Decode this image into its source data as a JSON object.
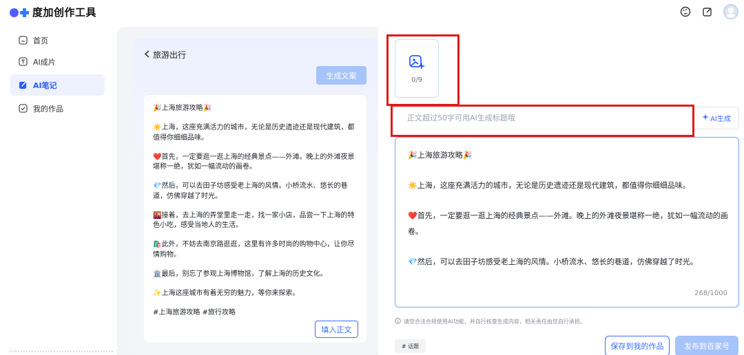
{
  "app": {
    "title": "度加创作工具"
  },
  "colors": {
    "accent": "#2b5cff",
    "highlight_box": "#e11a1a",
    "disabled_button": "#a6c3fb"
  },
  "sidebar": {
    "items": [
      {
        "label": "首页",
        "icon": "home-icon"
      },
      {
        "label": "AI成片",
        "icon": "ai-video-icon"
      },
      {
        "label": "AI笔记",
        "icon": "ai-note-icon",
        "active": true
      },
      {
        "label": "我的作品",
        "icon": "my-works-icon"
      }
    ]
  },
  "left": {
    "back_label": "旅游出行",
    "generate_button": "生成文案",
    "fill_button": "填入正文",
    "article": [
      "🎉上海旅游攻略🎉",
      "☀️上海，这座充满活力的城市，无论是历史遗迹还是现代建筑，都值得你细细品味。",
      "❤️首先，一定要逛一逛上海的经典景点——外滩。晚上的外滩夜景堪称一绝，犹如一幅流动的画卷。",
      "💎然后，可以去田子坊感受老上海的风情。小桥流水、悠长的巷道，仿佛穿越了时光。",
      "🌇接着，去上海的弄堂里走一走，找一家小店，品尝一下上海的特色小吃，感受当地人的生活。",
      "🛍️此外，不妨去南京路逛逛，这里有许多时尚的购物中心，让你尽情购物。",
      "🏛️最后，别忘了参观上海博物馆，了解上海的历史文化。",
      "✨上海这座城市有着无穷的魅力，等你来探索。",
      "#上海旅游攻略 #旅行攻略"
    ]
  },
  "right": {
    "upload_count": "0/9",
    "title_placeholder": "正文超过50字可用AI生成标题哦",
    "ai_button": "AI生成",
    "editor": [
      "🎉上海旅游攻略🎉",
      "☀️上海，这座充满活力的城市，无论是历史遗迹还是现代建筑，都值得你细细品味。",
      "❤️首先，一定要逛一逛上海的经典景点——外滩。晚上的外滩夜景堪称一绝，犹如一幅流动的画卷。",
      "💎然后，可以去田子坊感受老上海的风情。小桥流水、悠长的巷道，仿佛穿越了时光。"
    ],
    "counter": "268/1000",
    "notice": "请您合法合规使用AI功能，并自行核查生成内容，相关责任由您自行承担。",
    "tag_chip": "# 话题",
    "save_button": "保存到我的作品",
    "publish_button": "发布到百家号"
  }
}
